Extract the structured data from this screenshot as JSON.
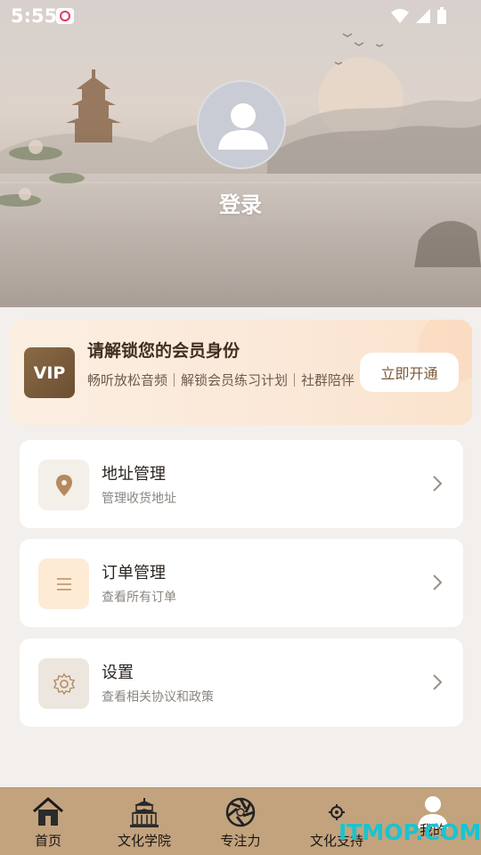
{
  "status": {
    "time": "5:55"
  },
  "profile": {
    "login_label": "登录"
  },
  "vip": {
    "badge": "VIP",
    "title": "请解锁您的会员身份",
    "description": "畅听放松音频｜解锁会员练习计划｜社群陪伴",
    "button": "立即开通"
  },
  "menu": [
    {
      "title": "地址管理",
      "subtitle": "管理收货地址",
      "icon": "location-pin-icon"
    },
    {
      "title": "订单管理",
      "subtitle": "查看所有订单",
      "icon": "list-icon"
    },
    {
      "title": "设置",
      "subtitle": "查看相关协议和政策",
      "icon": "gear-icon"
    }
  ],
  "nav": [
    {
      "label": "首页",
      "icon": "home-icon"
    },
    {
      "label": "文化学院",
      "icon": "academy-building-icon"
    },
    {
      "label": "专注力",
      "icon": "aperture-icon"
    },
    {
      "label": "文化支持",
      "icon": "support-emblem-icon"
    },
    {
      "label": "我的",
      "icon": "user-icon"
    }
  ],
  "watermark": "ITMOP.COM",
  "colors": {
    "nav_bg": "#c2a37e",
    "vip_badge": "#7a5a3c",
    "page_bg": "#f2efec"
  }
}
